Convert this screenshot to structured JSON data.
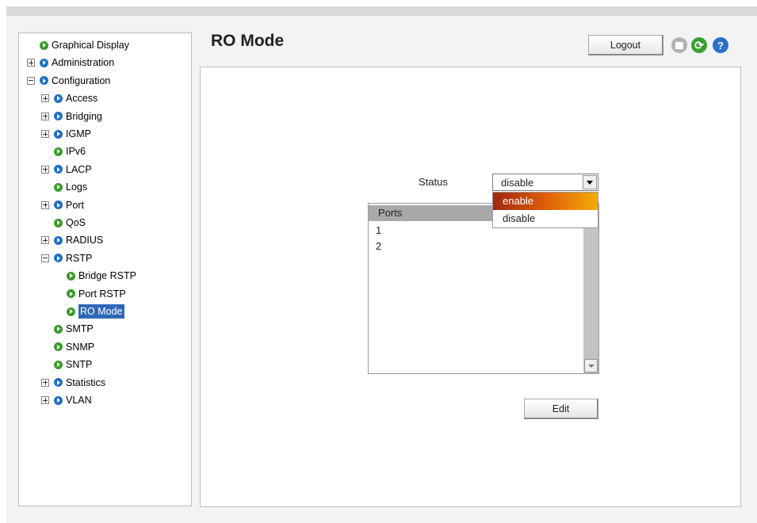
{
  "header": {
    "title": "RO Mode",
    "logout_label": "Logout",
    "help_glyph": "?"
  },
  "sidebar": {
    "items": [
      {
        "label": "Graphical Display",
        "expander": "none",
        "bullet": "green",
        "depth": 0
      },
      {
        "label": "Administration",
        "expander": "plus",
        "bullet": "blue",
        "depth": 0
      },
      {
        "label": "Configuration",
        "expander": "minus",
        "bullet": "blue",
        "depth": 0
      },
      {
        "label": "Access",
        "expander": "plus",
        "bullet": "blue",
        "depth": 1
      },
      {
        "label": "Bridging",
        "expander": "plus",
        "bullet": "blue",
        "depth": 1
      },
      {
        "label": "IGMP",
        "expander": "plus",
        "bullet": "blue",
        "depth": 1
      },
      {
        "label": "IPv6",
        "expander": "none",
        "bullet": "green",
        "depth": 1
      },
      {
        "label": "LACP",
        "expander": "plus",
        "bullet": "blue",
        "depth": 1
      },
      {
        "label": "Logs",
        "expander": "none",
        "bullet": "green",
        "depth": 1
      },
      {
        "label": "Port",
        "expander": "plus",
        "bullet": "blue",
        "depth": 1
      },
      {
        "label": "QoS",
        "expander": "none",
        "bullet": "green",
        "depth": 1
      },
      {
        "label": "RADIUS",
        "expander": "plus",
        "bullet": "blue",
        "depth": 1
      },
      {
        "label": "RSTP",
        "expander": "minus",
        "bullet": "blue",
        "depth": 1
      },
      {
        "label": "Bridge RSTP",
        "expander": "none",
        "bullet": "green",
        "depth": 2
      },
      {
        "label": "Port RSTP",
        "expander": "none",
        "bullet": "green",
        "depth": 2
      },
      {
        "label": "RO Mode",
        "expander": "none",
        "bullet": "green",
        "depth": 2,
        "selected": true
      },
      {
        "label": "SMTP",
        "expander": "none",
        "bullet": "green",
        "depth": 1
      },
      {
        "label": "SNMP",
        "expander": "none",
        "bullet": "green",
        "depth": 1
      },
      {
        "label": "SNTP",
        "expander": "none",
        "bullet": "green",
        "depth": 1
      },
      {
        "label": "Statistics",
        "expander": "plus",
        "bullet": "blue",
        "depth": 1
      },
      {
        "label": "VLAN",
        "expander": "plus",
        "bullet": "blue",
        "depth": 1
      }
    ]
  },
  "main": {
    "status_label": "Status",
    "status_value": "disable",
    "status_options": [
      {
        "label": "enable",
        "highlighted": true
      },
      {
        "label": "disable",
        "highlighted": false
      }
    ],
    "ports_header": "Ports",
    "ports": [
      "1",
      "2"
    ],
    "edit_label": "Edit"
  },
  "icons": {
    "save": "save-icon",
    "refresh": "refresh-icon",
    "help": "help-icon",
    "bullet": "arrow-bullet-icon",
    "expander": "tree-expander-icon"
  },
  "colors": {
    "selected_item": "#2f67b8",
    "bullet_green": "#3a9a2a",
    "bullet_blue": "#1f6ec4",
    "dropdown_highlight_start": "#a0260e",
    "dropdown_highlight_end": "#f3ac06",
    "ports_header_bg": "#a9a9a9"
  }
}
